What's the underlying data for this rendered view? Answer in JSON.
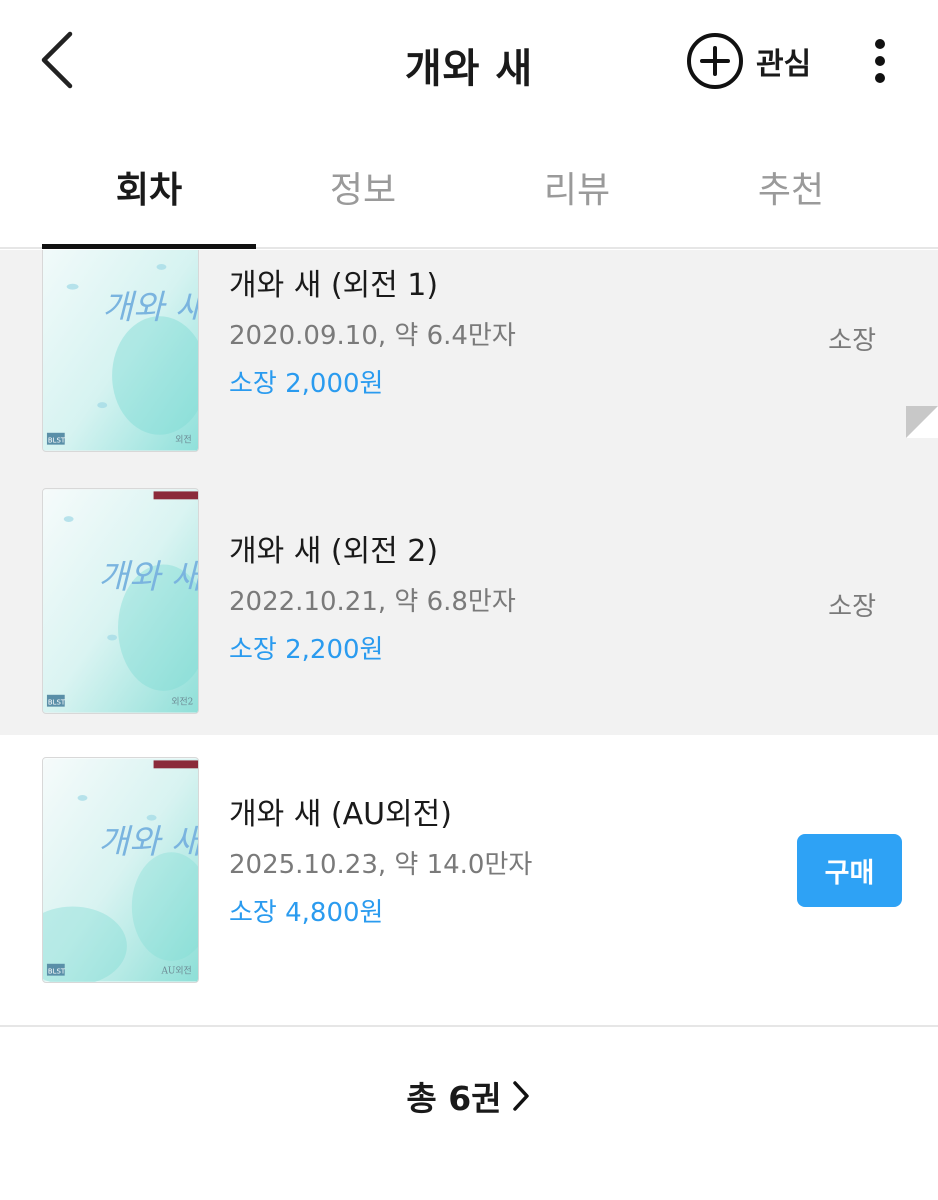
{
  "header": {
    "title": "개와 새",
    "favorite_label": "관심"
  },
  "tabs": [
    {
      "label": "회차",
      "active": true
    },
    {
      "label": "정보",
      "active": false
    },
    {
      "label": "리뷰",
      "active": false
    },
    {
      "label": "추천",
      "active": false
    }
  ],
  "episodes": [
    {
      "title": "개와 새 (외전 1)",
      "meta": "2020.09.10, 약 6.4만자",
      "price": "소장 2,000원",
      "status": "소장",
      "cover_text": "개와 새",
      "cover_badge": "BLST",
      "cover_sub": "외전"
    },
    {
      "title": "개와 새 (외전 2)",
      "meta": "2022.10.21, 약 6.8만자",
      "price": "소장 2,200원",
      "status": "소장",
      "cover_text": "개와 새",
      "cover_badge": "BLST",
      "cover_sub": "외전2"
    },
    {
      "title": "개와 새 (AU외전)",
      "meta": "2025.10.23, 약 14.0만자",
      "price": "소장 4,800원",
      "action_label": "구매",
      "cover_text": "개와 새",
      "cover_badge": "BLST",
      "cover_sub": "AU외전"
    }
  ],
  "footer": {
    "total_label": "총 6권"
  },
  "colors": {
    "accent": "#2a9bef",
    "buy_button": "#2ea2f5",
    "owned_row_bg": "#f2f2f2"
  }
}
